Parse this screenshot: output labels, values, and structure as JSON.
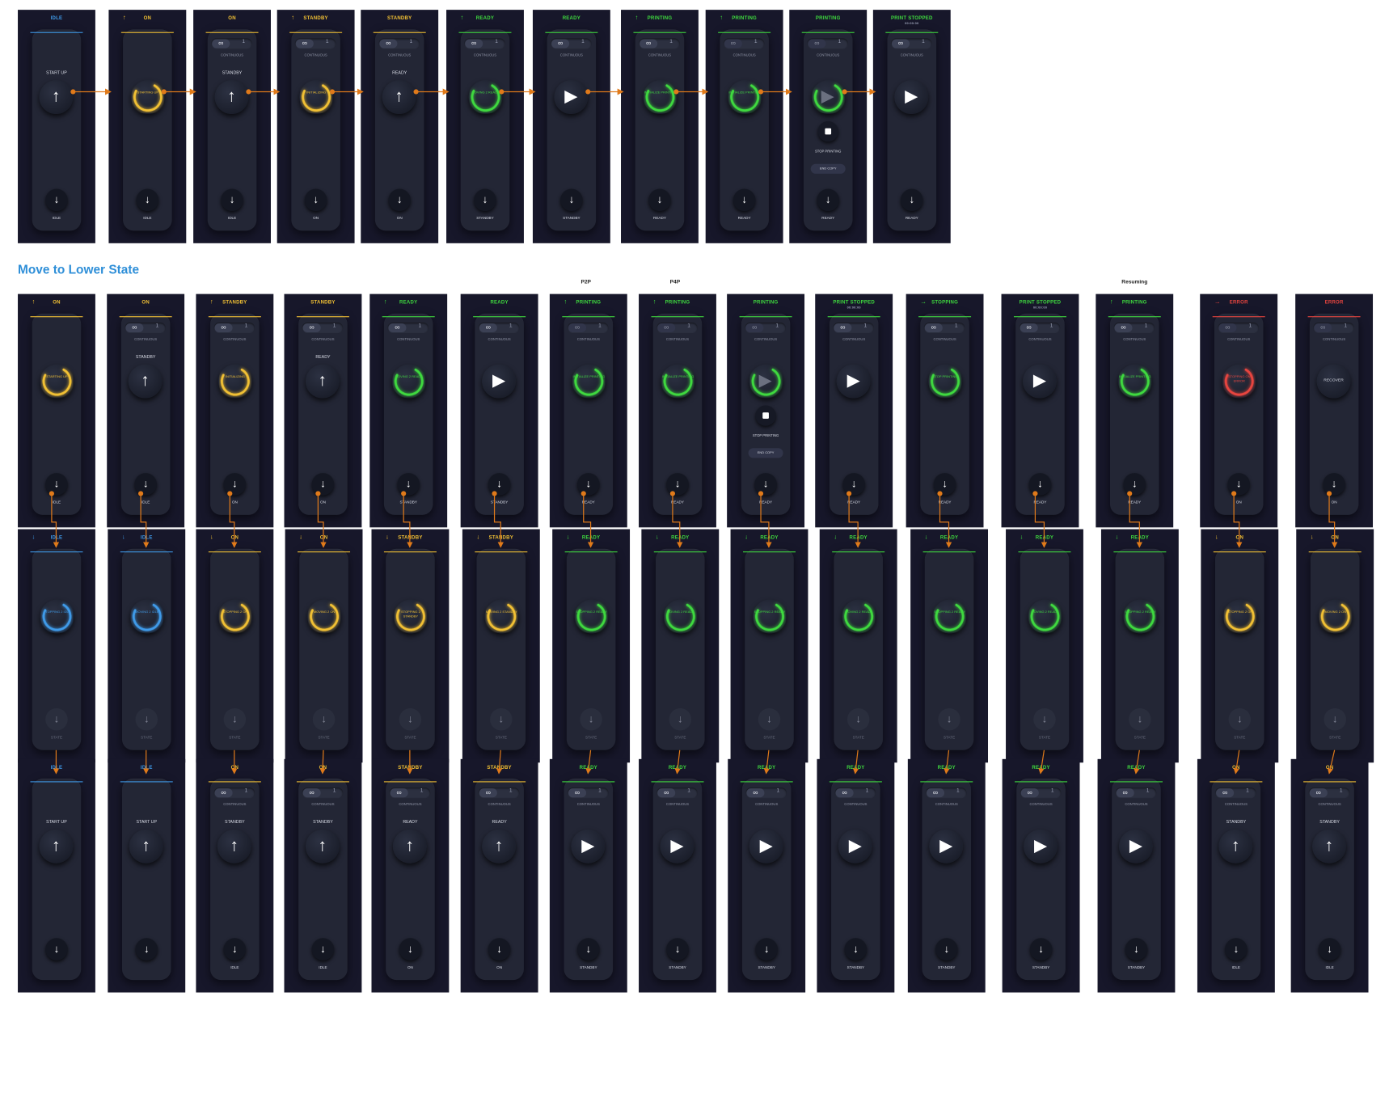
{
  "section_title": "Move to Lower State",
  "column_labels": [
    "P2P",
    "P4P",
    "Resuming"
  ],
  "colors": {
    "idle": "#3f9ae8",
    "on": "#f1c034",
    "ready": "#3fd93f",
    "error": "#e8453f",
    "arrow": "#e07a1a",
    "background": "#17172a"
  },
  "panels": [
    {
      "header": "IDLE",
      "color": "blue",
      "arrow": "",
      "toggle": false,
      "middle_label": "START UP",
      "center": {
        "type": "button",
        "glyph": "up-arrow"
      },
      "down_label": "IDLE"
    },
    {
      "header": "ON",
      "color": "yellow",
      "arrow": "↑",
      "toggle": false,
      "center": {
        "type": "ring",
        "text": "STARTING UP"
      },
      "down_label": "IDLE"
    },
    {
      "header": "ON",
      "color": "yellow",
      "arrow": "",
      "toggle": true,
      "cont": "CONTINUOUS",
      "middle_label": "STANDBY",
      "center": {
        "type": "button",
        "glyph": "up-arrow"
      },
      "down_label": "IDLE"
    },
    {
      "header": "STANDBY",
      "color": "yellow",
      "arrow": "↑",
      "toggle": true,
      "cont": "CONTINUOUS",
      "center": {
        "type": "ring",
        "text": "INITIALIZING"
      },
      "down_label": "ON"
    },
    {
      "header": "STANDBY",
      "color": "yellow",
      "arrow": "",
      "toggle": true,
      "cont": "CONTINUOUS",
      "middle_label": "READY",
      "center": {
        "type": "button",
        "glyph": "up-arrow"
      },
      "down_label": "ON"
    },
    {
      "header": "READY",
      "color": "green",
      "arrow": "↑",
      "toggle": true,
      "cont": "CONTINUOUS",
      "center": {
        "type": "ring",
        "text": "MOVING 2 READY"
      },
      "down_label": "STANDBY"
    },
    {
      "header": "READY",
      "color": "green",
      "arrow": "",
      "toggle": true,
      "cont": "CONTINUOUS",
      "center": {
        "type": "button",
        "glyph": "play"
      },
      "down_label": "STANDBY"
    },
    {
      "header": "PRINTING",
      "color": "green",
      "arrow": "↑",
      "toggle": true,
      "cont": "CONTINUOUS",
      "center": {
        "type": "ring",
        "text": "INITIALIZE PRINTING"
      },
      "down_label": "READY"
    },
    {
      "header": "PRINTING",
      "color": "green",
      "arrow": "↑",
      "toggle": true,
      "dim": true,
      "cont": "CONTINUOUS",
      "center": {
        "type": "ring",
        "text": "INITIALIZE PRINTING"
      },
      "down_label": "READY"
    },
    {
      "header": "PRINTING",
      "color": "green",
      "arrow": "",
      "toggle": true,
      "dim": true,
      "cont": "CONTINUOUS",
      "center": {
        "type": "ringplay"
      },
      "stop": "STOP PRINTING",
      "end": "END COPY",
      "down_label": "READY"
    },
    {
      "header": "PRINT STOPPED",
      "sub": "00:00:00",
      "color": "green",
      "arrow": "",
      "toggle": true,
      "cont": "CONTINUOUS",
      "center": {
        "type": "button",
        "glyph": "play"
      },
      "down_label": "READY"
    },
    {
      "header": "ON",
      "color": "yellow",
      "arrow": "↑",
      "toggle": false,
      "center": {
        "type": "ring",
        "text": "STARTING UP"
      },
      "down_label": "IDLE"
    },
    {
      "header": "ON",
      "color": "yellow",
      "arrow": "",
      "toggle": true,
      "cont": "CONTINUOUS",
      "middle_label": "STANDBY",
      "center": {
        "type": "button",
        "glyph": "up-arrow"
      },
      "down_label": "IDLE"
    },
    {
      "header": "STANDBY",
      "color": "yellow",
      "arrow": "↑",
      "toggle": true,
      "cont": "CONTINUOUS",
      "center": {
        "type": "ring",
        "text": "INITIALIZING"
      },
      "down_label": "ON"
    },
    {
      "header": "STANDBY",
      "color": "yellow",
      "arrow": "",
      "toggle": true,
      "cont": "CONTINUOUS",
      "middle_label": "READY",
      "center": {
        "type": "button",
        "glyph": "up-arrow"
      },
      "down_label": "ON"
    },
    {
      "header": "READY",
      "color": "green",
      "arrow": "↑",
      "toggle": true,
      "cont": "CONTINUOUS",
      "center": {
        "type": "ring",
        "text": "MOVING 2 READY"
      },
      "down_label": "STANDBY"
    },
    {
      "header": "READY",
      "color": "green",
      "arrow": "",
      "toggle": true,
      "cont": "CONTINUOUS",
      "center": {
        "type": "button",
        "glyph": "play"
      },
      "down_label": "STANDBY"
    },
    {
      "header": "PRINTING",
      "color": "green",
      "arrow": "↑",
      "toggle": true,
      "dim": true,
      "cont": "CONTINUOUS",
      "center": {
        "type": "ring",
        "text": "INITIALIZE PRINTING"
      },
      "down_label": "READY"
    },
    {
      "header": "PRINTING",
      "color": "green",
      "arrow": "↑",
      "toggle": true,
      "dim": true,
      "cont": "CONTINUOUS",
      "center": {
        "type": "ring",
        "text": "INITIALIZE PRINTING"
      },
      "down_label": "READY"
    },
    {
      "header": "PRINTING",
      "color": "green",
      "arrow": "",
      "toggle": true,
      "dim": true,
      "cont": "CONTINUOUS",
      "center": {
        "type": "ringplay"
      },
      "stop": "STOP PRINTING",
      "end": "END COPY",
      "down_label": "READY"
    },
    {
      "header": "PRINT STOPPED",
      "sub": "00:00:00",
      "color": "green",
      "arrow": "",
      "toggle": true,
      "cont": "CONTINUOUS",
      "center": {
        "type": "button",
        "glyph": "play"
      },
      "down_label": "READY"
    },
    {
      "header": "STOPPING",
      "color": "green",
      "arrow": "→",
      "toggle": true,
      "cont": "CONTINUOUS",
      "center": {
        "type": "ring",
        "text": "STOP PRINTING"
      },
      "down_label": "READY"
    },
    {
      "header": "PRINT STOPPED",
      "sub": "00:00:00",
      "color": "green",
      "arrow": "",
      "toggle": true,
      "cont": "CONTINUOUS",
      "center": {
        "type": "button",
        "glyph": "play"
      },
      "down_label": "READY"
    },
    {
      "header": "PRINTING",
      "color": "green",
      "arrow": "↑",
      "toggle": true,
      "cont": "CONTINUOUS",
      "center": {
        "type": "ring",
        "text": "INITIALIZE PRINTING"
      },
      "down_label": "READY"
    },
    {
      "header": "ERROR",
      "color": "red",
      "arrow": "→",
      "toggle": true,
      "dim": true,
      "cont": "CONTINUOUS",
      "center": {
        "type": "ring",
        "text": "STOPPING ON ERROR"
      },
      "down_label": "ON"
    },
    {
      "header": "ERROR",
      "color": "red",
      "arrow": "",
      "toggle": true,
      "dim": true,
      "cont": "CONTINUOUS",
      "center": {
        "type": "button",
        "glyph": "text",
        "text": "RECOVER"
      },
      "down_label": "ON"
    },
    {
      "header": "IDLE",
      "color": "blue",
      "arrow": "↓",
      "toggle": false,
      "center": {
        "type": "ring",
        "text": "STOPPING 2 IDLE"
      },
      "down_label": "STATE",
      "down_dim": true
    },
    {
      "header": "IDLE",
      "color": "blue",
      "arrow": "↓",
      "toggle": false,
      "center": {
        "type": "ring",
        "text": "MOVING 2 IDLE"
      },
      "down_label": "STATE",
      "down_dim": true
    },
    {
      "header": "ON",
      "color": "yellow",
      "arrow": "↓",
      "toggle": false,
      "center": {
        "type": "ring",
        "text": "STOPPING 2 ON"
      },
      "down_label": "STATE",
      "down_dim": true
    },
    {
      "header": "ON",
      "color": "yellow",
      "arrow": "↓",
      "toggle": false,
      "center": {
        "type": "ring",
        "text": "MOVING 2 ON"
      },
      "down_label": "STATE",
      "down_dim": true
    },
    {
      "header": "STANDBY",
      "color": "yellow",
      "arrow": "↓",
      "toggle": false,
      "center": {
        "type": "ring",
        "text": "STOPPING 2 STANDBY"
      },
      "down_label": "STATE",
      "down_dim": true
    },
    {
      "header": "STANDBY",
      "color": "yellow",
      "arrow": "↓",
      "toggle": false,
      "center": {
        "type": "ring",
        "text": "MOVING 2 STANDBY"
      },
      "down_label": "STATE",
      "down_dim": true
    },
    {
      "header": "READY",
      "color": "green",
      "arrow": "↓",
      "toggle": false,
      "center": {
        "type": "ring",
        "text": "STOPPING 2 READY"
      },
      "down_label": "STATE",
      "down_dim": true
    },
    {
      "header": "READY",
      "color": "green",
      "arrow": "↓",
      "toggle": false,
      "center": {
        "type": "ring",
        "text": "MOVING 2 READY"
      },
      "down_label": "STATE",
      "down_dim": true
    },
    {
      "header": "READY",
      "color": "green",
      "arrow": "↓",
      "toggle": false,
      "center": {
        "type": "ring",
        "text": "STOPPING 2 READY"
      },
      "down_label": "STATE",
      "down_dim": true
    },
    {
      "header": "READY",
      "color": "green",
      "arrow": "↓",
      "toggle": false,
      "center": {
        "type": "ring",
        "text": "MOVING 2 READY"
      },
      "down_label": "STATE",
      "down_dim": true
    },
    {
      "header": "READY",
      "color": "green",
      "arrow": "↓",
      "toggle": false,
      "center": {
        "type": "ring",
        "text": "STOPPING 2 READY"
      },
      "down_label": "STATE",
      "down_dim": true
    },
    {
      "header": "READY",
      "color": "green",
      "arrow": "↓",
      "toggle": false,
      "center": {
        "type": "ring",
        "text": "MOVING 2 READY"
      },
      "down_label": "STATE",
      "down_dim": true
    },
    {
      "header": "READY",
      "color": "green",
      "arrow": "↓",
      "toggle": false,
      "center": {
        "type": "ring",
        "text": "STOPPING 2 READY"
      },
      "down_label": "STATE",
      "down_dim": true
    },
    {
      "header": "ON",
      "color": "yellow",
      "arrow": "↓",
      "toggle": false,
      "center": {
        "type": "ring",
        "text": "STOPPING 2 ON"
      },
      "down_label": "STATE",
      "down_dim": true
    },
    {
      "header": "ON",
      "color": "yellow",
      "arrow": "↓",
      "toggle": false,
      "center": {
        "type": "ring",
        "text": "MOVING 2 ON"
      },
      "down_label": "STATE",
      "down_dim": true
    },
    {
      "header": "IDLE",
      "color": "blue",
      "arrow": "",
      "toggle": false,
      "middle_label": "START UP",
      "center": {
        "type": "button",
        "glyph": "up-arrow"
      },
      "down_label": ""
    },
    {
      "header": "IDLE",
      "color": "blue",
      "arrow": "",
      "toggle": false,
      "middle_label": "START UP",
      "center": {
        "type": "button",
        "glyph": "up-arrow"
      },
      "down_label": ""
    },
    {
      "header": "ON",
      "color": "yellow",
      "arrow": "",
      "toggle": true,
      "cont": "CONTINUOUS",
      "middle_label": "STANDBY",
      "center": {
        "type": "button",
        "glyph": "up-arrow"
      },
      "down_label": "IDLE"
    },
    {
      "header": "ON",
      "color": "yellow",
      "arrow": "",
      "toggle": true,
      "cont": "CONTINUOUS",
      "middle_label": "STANDBY",
      "center": {
        "type": "button",
        "glyph": "up-arrow"
      },
      "down_label": "IDLE"
    },
    {
      "header": "STANDBY",
      "color": "yellow",
      "arrow": "",
      "toggle": true,
      "cont": "CONTINUOUS",
      "middle_label": "READY",
      "center": {
        "type": "button",
        "glyph": "up-arrow"
      },
      "down_label": "ON"
    },
    {
      "header": "STANDBY",
      "color": "yellow",
      "arrow": "",
      "toggle": true,
      "cont": "CONTINUOUS",
      "middle_label": "READY",
      "center": {
        "type": "button",
        "glyph": "up-arrow"
      },
      "down_label": "ON"
    },
    {
      "header": "READY",
      "color": "green",
      "arrow": "",
      "toggle": true,
      "cont": "CONTINUOUS",
      "center": {
        "type": "button",
        "glyph": "play"
      },
      "down_label": "STANDBY"
    },
    {
      "header": "READY",
      "color": "green",
      "arrow": "",
      "toggle": true,
      "cont": "CONTINUOUS",
      "center": {
        "type": "button",
        "glyph": "play"
      },
      "down_label": "STANDBY"
    },
    {
      "header": "READY",
      "color": "green",
      "arrow": "",
      "toggle": true,
      "cont": "CONTINUOUS",
      "center": {
        "type": "button",
        "glyph": "play"
      },
      "down_label": "STANDBY"
    },
    {
      "header": "READY",
      "color": "green",
      "arrow": "",
      "toggle": true,
      "cont": "CONTINUOUS",
      "center": {
        "type": "button",
        "glyph": "play"
      },
      "down_label": "STANDBY"
    },
    {
      "header": "READY",
      "color": "green",
      "arrow": "",
      "toggle": true,
      "cont": "CONTINUOUS",
      "center": {
        "type": "button",
        "glyph": "play"
      },
      "down_label": "STANDBY"
    },
    {
      "header": "READY",
      "color": "green",
      "arrow": "",
      "toggle": true,
      "cont": "CONTINUOUS",
      "center": {
        "type": "button",
        "glyph": "play"
      },
      "down_label": "STANDBY"
    },
    {
      "header": "READY",
      "color": "green",
      "arrow": "",
      "toggle": true,
      "cont": "CONTINUOUS",
      "center": {
        "type": "button",
        "glyph": "play"
      },
      "down_label": "STANDBY"
    },
    {
      "header": "ON",
      "color": "yellow",
      "arrow": "",
      "toggle": true,
      "cont": "CONTINUOUS",
      "middle_label": "STANDBY",
      "center": {
        "type": "button",
        "glyph": "up-arrow"
      },
      "down_label": "IDLE"
    },
    {
      "header": "ON",
      "color": "yellow",
      "arrow": "",
      "toggle": true,
      "cont": "CONTINUOUS",
      "middle_label": "STANDBY",
      "center": {
        "type": "button",
        "glyph": "up-arrow"
      },
      "down_label": "IDLE"
    }
  ]
}
